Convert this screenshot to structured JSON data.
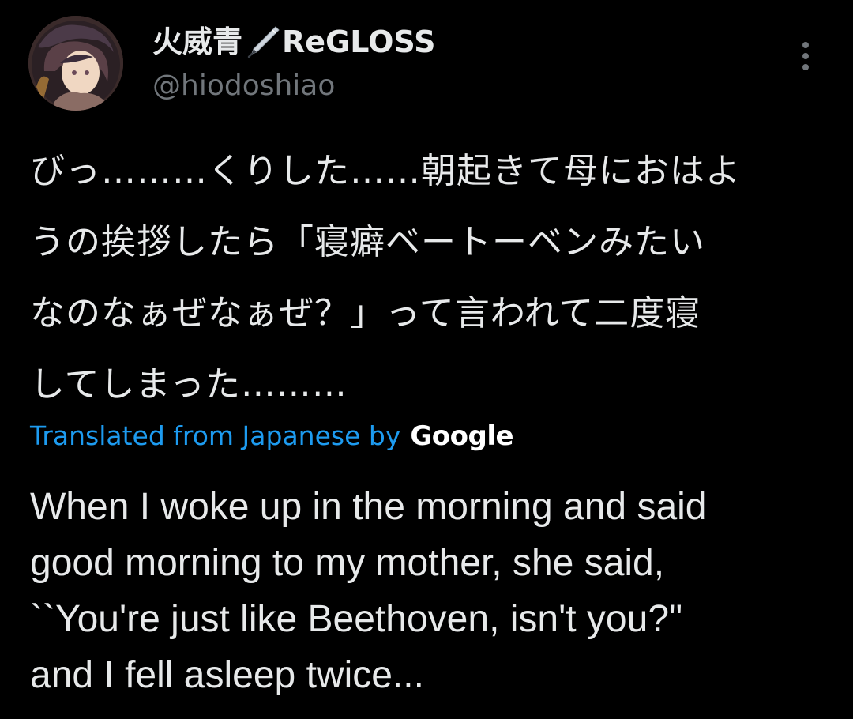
{
  "tweet": {
    "author": {
      "name": "火威青",
      "name_suffix": "ReGLOSS",
      "name_icon": "fountain-pen-icon",
      "handle": "@hiodoshiao",
      "avatar": "avatar"
    },
    "more_icon": "more-options-icon",
    "original_lines": [
      "びっ………くりした……朝起きて母におはよ",
      "うの挨拶したら「寝癖ベートーベンみたい",
      "なのなぁぜなぁぜ？」って言われて二度寝",
      "してしまった………"
    ],
    "translation_credit": {
      "label": "Translated from Japanese by",
      "provider": "Google"
    },
    "translated_lines": [
      "When I woke up in the morning and said",
      "good morning to my mother, she said,",
      "``You're just like Beethoven, isn't you?\"",
      "and I fell asleep twice..."
    ]
  },
  "colors": {
    "background": "#000000",
    "text_primary": "#e7e9ea",
    "text_secondary": "#71767b",
    "link": "#1d9bf0"
  }
}
